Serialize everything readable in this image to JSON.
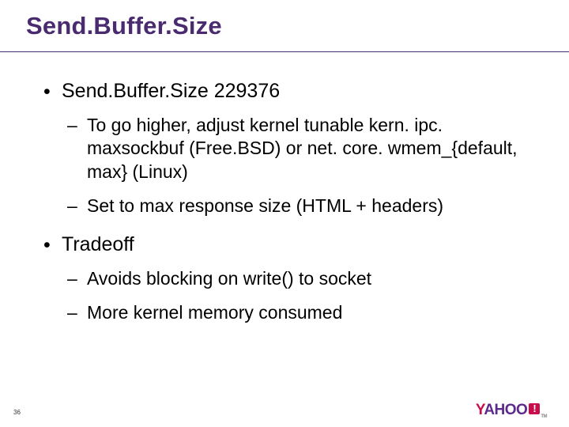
{
  "title": "Send.Buffer.Size",
  "bullets": {
    "b1_label": "Send.Buffer.Size 229376",
    "b1_sub1": "To go higher, adjust kernel tunable kern. ipc. maxsockbuf (Free.BSD) or net. core. wmem_{default, max} (Linux)",
    "b1_sub2": "Set to max response size (HTML + headers)",
    "b2_label": "Tradeoff",
    "b2_sub1": "Avoids blocking on write() to socket",
    "b2_sub2": "More kernel memory consumed"
  },
  "pagenum": "36",
  "logo": {
    "y": "Y",
    "ahoo": "AHOO",
    "bang": "!",
    "tm": "TM"
  }
}
